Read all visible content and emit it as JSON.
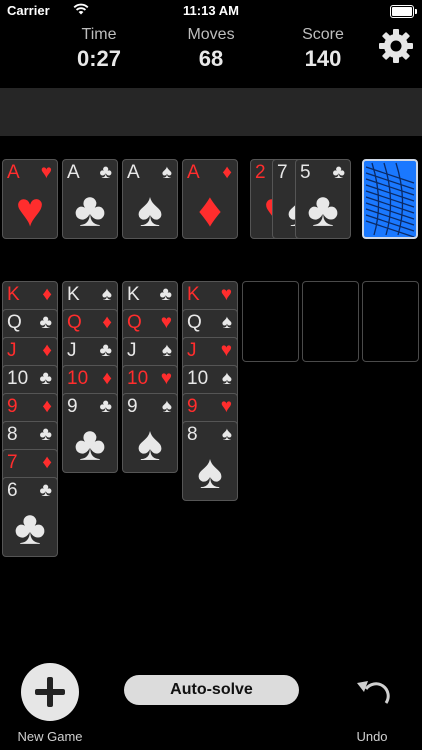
{
  "status_bar": {
    "carrier": "Carrier",
    "time": "11:13 AM"
  },
  "stats": {
    "time_label": "Time",
    "time_value": "0:27",
    "moves_label": "Moves",
    "moves_value": "68",
    "score_label": "Score",
    "score_value": "140"
  },
  "foundations": [
    {
      "rank": "A",
      "suit": "♥",
      "color": "red"
    },
    {
      "rank": "A",
      "suit": "♣",
      "color": "white"
    },
    {
      "rank": "A",
      "suit": "♠",
      "color": "white"
    },
    {
      "rank": "A",
      "suit": "♦",
      "color": "red"
    }
  ],
  "waste": [
    {
      "rank": "2",
      "suit": "♥",
      "color": "red"
    },
    {
      "rank": "7",
      "suit": "♠",
      "color": "white"
    },
    {
      "rank": "5",
      "suit": "♣",
      "color": "white"
    }
  ],
  "stock": {
    "icon": "card-back-icon"
  },
  "tableau": [
    {
      "cards": [
        {
          "rank": "K",
          "suit": "♦",
          "color": "red"
        },
        {
          "rank": "Q",
          "suit": "♣",
          "color": "white"
        },
        {
          "rank": "J",
          "suit": "♦",
          "color": "red"
        },
        {
          "rank": "10",
          "suit": "♣",
          "color": "white"
        },
        {
          "rank": "9",
          "suit": "♦",
          "color": "red"
        },
        {
          "rank": "8",
          "suit": "♣",
          "color": "white"
        },
        {
          "rank": "7",
          "suit": "♦",
          "color": "red"
        },
        {
          "rank": "6",
          "suit": "♣",
          "color": "white"
        }
      ]
    },
    {
      "cards": [
        {
          "rank": "K",
          "suit": "♠",
          "color": "white"
        },
        {
          "rank": "Q",
          "suit": "♦",
          "color": "red"
        },
        {
          "rank": "J",
          "suit": "♣",
          "color": "white"
        },
        {
          "rank": "10",
          "suit": "♦",
          "color": "red"
        },
        {
          "rank": "9",
          "suit": "♣",
          "color": "white"
        }
      ]
    },
    {
      "cards": [
        {
          "rank": "K",
          "suit": "♣",
          "color": "white"
        },
        {
          "rank": "Q",
          "suit": "♥",
          "color": "red"
        },
        {
          "rank": "J",
          "suit": "♠",
          "color": "white"
        },
        {
          "rank": "10",
          "suit": "♥",
          "color": "red"
        },
        {
          "rank": "9",
          "suit": "♠",
          "color": "white"
        }
      ]
    },
    {
      "cards": [
        {
          "rank": "K",
          "suit": "♥",
          "color": "red"
        },
        {
          "rank": "Q",
          "suit": "♠",
          "color": "white"
        },
        {
          "rank": "J",
          "suit": "♥",
          "color": "red"
        },
        {
          "rank": "10",
          "suit": "♠",
          "color": "white"
        },
        {
          "rank": "9",
          "suit": "♥",
          "color": "red"
        },
        {
          "rank": "8",
          "suit": "♠",
          "color": "white"
        }
      ]
    },
    {
      "cards": []
    },
    {
      "cards": []
    },
    {
      "cards": []
    }
  ],
  "bottom_bar": {
    "new_game_label": "New Game",
    "auto_solve_label": "Auto-solve",
    "undo_label": "Undo"
  },
  "colors": {
    "red_suit": "#ff2d2d",
    "card_face": "#2e2e2e",
    "card_back": "#1a78ff",
    "top_band": "#262626"
  }
}
